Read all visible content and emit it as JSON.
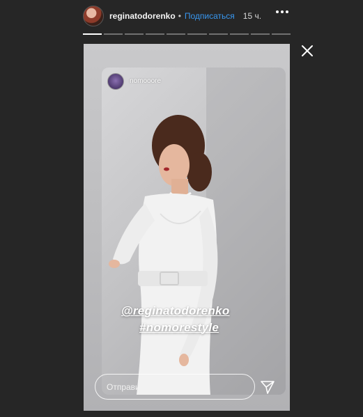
{
  "header": {
    "username": "reginatodorenko",
    "dot": "•",
    "follow_label": "Подписаться",
    "time": "15 ч."
  },
  "progress": {
    "segments": [
      1,
      0,
      0,
      0,
      0,
      0,
      0,
      0,
      0,
      0
    ]
  },
  "story": {
    "inner_username": "nomooore",
    "tag_user": "@reginatodorenko",
    "tag_hashtag": "#nomorestyle"
  },
  "reply": {
    "placeholder": "Отправить сообщение"
  },
  "icons": {
    "more": "more-horizontal-icon",
    "close": "close-icon",
    "send": "send-icon"
  }
}
